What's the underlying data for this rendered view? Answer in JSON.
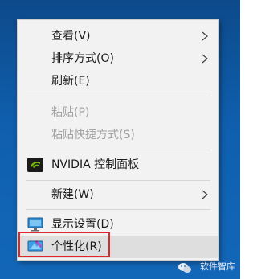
{
  "menu": {
    "view": {
      "label": "查看(V)"
    },
    "sort_by": {
      "label": "排序方式(O)"
    },
    "refresh": {
      "label": "刷新(E)"
    },
    "paste": {
      "label": "粘贴(P)"
    },
    "paste_shortcut": {
      "label": "粘贴快捷方式(S)"
    },
    "nvidia": {
      "label": "NVIDIA 控制面板",
      "icon": "nvidia-icon"
    },
    "new": {
      "label": "新建(W)"
    },
    "display_settings": {
      "label": "显示设置(D)",
      "icon": "display-icon"
    },
    "personalize": {
      "label": "个性化(R)",
      "icon": "personalize-icon"
    }
  },
  "watermark": {
    "text": "软件智库"
  },
  "colors": {
    "desktop": "#0f5fae",
    "menu_bg": "#f2f2f2",
    "hover": "#dedede",
    "highlight_border": "#e0262d",
    "disabled_text": "#a0a0a0"
  }
}
